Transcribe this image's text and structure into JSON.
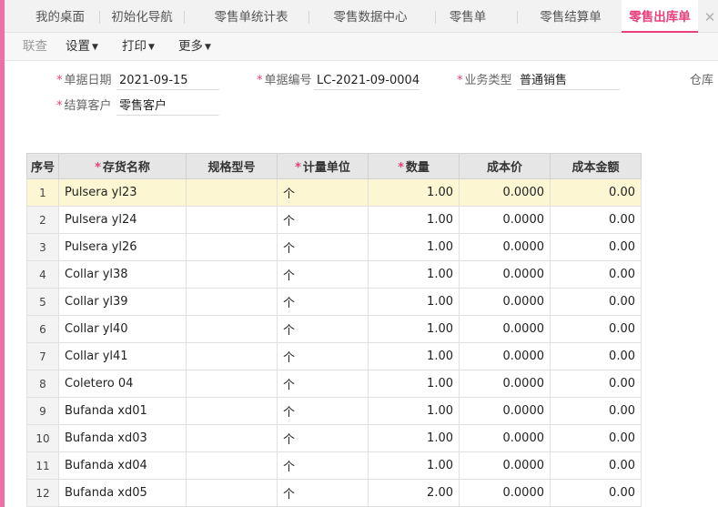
{
  "tabs": [
    {
      "label": "我的桌面",
      "active": false
    },
    {
      "label": "初始化导航",
      "active": false
    },
    {
      "label": "零售单统计表",
      "active": false
    },
    {
      "label": "零售数据中心",
      "active": false
    },
    {
      "label": "零售单",
      "active": false
    },
    {
      "label": "零售结算单",
      "active": false
    },
    {
      "label": "零售出库单",
      "active": true
    }
  ],
  "tab_close_glyph": "✕",
  "toolbar": {
    "audit": "联查",
    "settings": "设置",
    "print": "打印",
    "more": "更多",
    "caret": "▼"
  },
  "form": {
    "required_mark": "*",
    "doc_date_label": "单据日期",
    "doc_date_value": "2021-09-15",
    "doc_no_label": "单据编号",
    "doc_no_value": "LC-2021-09-0004",
    "biz_type_label": "业务类型",
    "biz_type_value": "普通销售",
    "warehouse_label": "仓库",
    "customer_label": "结算客户",
    "customer_value": "零售客户"
  },
  "table": {
    "headers": {
      "seq": "序号",
      "name": "存货名称",
      "spec": "规格型号",
      "unit": "计量单位",
      "qty": "数量",
      "cost": "成本价",
      "amount": "成本金额"
    },
    "rows": [
      {
        "seq": "1",
        "name": "Pulsera yl23",
        "spec": "",
        "unit": "个",
        "qty": "1.00",
        "cost": "0.0000",
        "amount": "0.00"
      },
      {
        "seq": "2",
        "name": "Pulsera yl24",
        "spec": "",
        "unit": "个",
        "qty": "1.00",
        "cost": "0.0000",
        "amount": "0.00"
      },
      {
        "seq": "3",
        "name": "Pulsera yl26",
        "spec": "",
        "unit": "个",
        "qty": "1.00",
        "cost": "0.0000",
        "amount": "0.00"
      },
      {
        "seq": "4",
        "name": "Collar yl38",
        "spec": "",
        "unit": "个",
        "qty": "1.00",
        "cost": "0.0000",
        "amount": "0.00"
      },
      {
        "seq": "5",
        "name": "Collar yl39",
        "spec": "",
        "unit": "个",
        "qty": "1.00",
        "cost": "0.0000",
        "amount": "0.00"
      },
      {
        "seq": "6",
        "name": "Collar yl40",
        "spec": "",
        "unit": "个",
        "qty": "1.00",
        "cost": "0.0000",
        "amount": "0.00"
      },
      {
        "seq": "7",
        "name": "Collar yl41",
        "spec": "",
        "unit": "个",
        "qty": "1.00",
        "cost": "0.0000",
        "amount": "0.00"
      },
      {
        "seq": "8",
        "name": "Coletero 04",
        "spec": "",
        "unit": "个",
        "qty": "1.00",
        "cost": "0.0000",
        "amount": "0.00"
      },
      {
        "seq": "9",
        "name": "Bufanda xd01",
        "spec": "",
        "unit": "个",
        "qty": "1.00",
        "cost": "0.0000",
        "amount": "0.00"
      },
      {
        "seq": "10",
        "name": "Bufanda xd03",
        "spec": "",
        "unit": "个",
        "qty": "1.00",
        "cost": "0.0000",
        "amount": "0.00"
      },
      {
        "seq": "11",
        "name": "Bufanda xd04",
        "spec": "",
        "unit": "个",
        "qty": "1.00",
        "cost": "0.0000",
        "amount": "0.00"
      },
      {
        "seq": "12",
        "name": "Bufanda xd05",
        "spec": "",
        "unit": "个",
        "qty": "2.00",
        "cost": "0.0000",
        "amount": "0.00"
      }
    ]
  },
  "colors": {
    "accent": "#e8407c",
    "frame": "#f06fa6",
    "selected_row": "#fdf6d3"
  }
}
